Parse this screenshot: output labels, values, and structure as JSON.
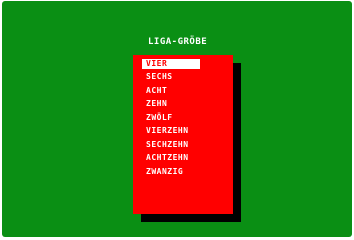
{
  "colors": {
    "background": "#0a8f14",
    "menu": "#ff0000",
    "shadow": "#000000",
    "text": "#ffffff",
    "selected_bg": "#ffffff",
    "selected_text": "#ff0000"
  },
  "title": "LIGA-GRÖBE",
  "menu": {
    "items": [
      {
        "label": "VIER",
        "selected": true
      },
      {
        "label": "SECHS",
        "selected": false
      },
      {
        "label": "ACHT",
        "selected": false
      },
      {
        "label": "ZEHN",
        "selected": false
      },
      {
        "label": "ZWÖLF",
        "selected": false
      },
      {
        "label": "VIERZEHN",
        "selected": false
      },
      {
        "label": "SECHZEHN",
        "selected": false
      },
      {
        "label": "ACHTZEHN",
        "selected": false
      },
      {
        "label": "ZWANZIG",
        "selected": false
      }
    ]
  }
}
